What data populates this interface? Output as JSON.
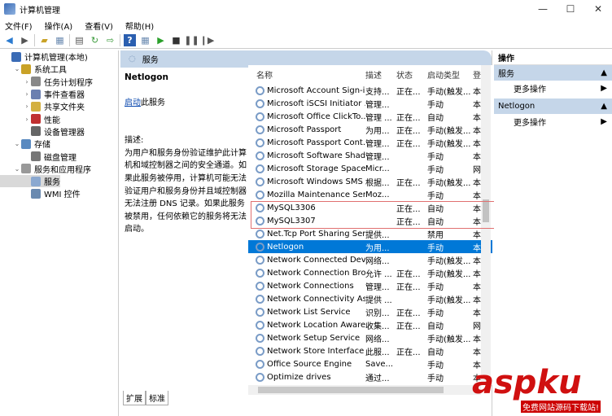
{
  "window": {
    "title": "计算机管理",
    "controls": [
      "—",
      "☐",
      "✕"
    ]
  },
  "menu": [
    "文件(F)",
    "操作(A)",
    "查看(V)",
    "帮助(H)"
  ],
  "toolbar": {
    "icons": [
      "back-icon",
      "forward-icon",
      "up-folder-icon",
      "show-hide-tree-icon",
      "properties-icon",
      "refresh-icon",
      "export-icon",
      "help-icon",
      "console-icon",
      "play-icon",
      "stop-icon",
      "pause-icon",
      "resume-icon"
    ]
  },
  "tree": [
    {
      "label": "计算机管理(本地)",
      "level": 0,
      "arrow": "",
      "color": "#3a6bb5"
    },
    {
      "label": "系统工具",
      "level": 1,
      "arrow": "⌄",
      "color": "#c9a227"
    },
    {
      "label": "任务计划程序",
      "level": 2,
      "arrow": "›",
      "color": "#888"
    },
    {
      "label": "事件查看器",
      "level": 2,
      "arrow": "›",
      "color": "#6b7fb0"
    },
    {
      "label": "共享文件夹",
      "level": 2,
      "arrow": "›",
      "color": "#d4b040"
    },
    {
      "label": "性能",
      "level": 2,
      "arrow": "›",
      "color": "#c03030"
    },
    {
      "label": "设备管理器",
      "level": 2,
      "arrow": "",
      "color": "#666"
    },
    {
      "label": "存储",
      "level": 1,
      "arrow": "⌄",
      "color": "#5a8ac0"
    },
    {
      "label": "磁盘管理",
      "level": 2,
      "arrow": "",
      "color": "#777"
    },
    {
      "label": "服务和应用程序",
      "level": 1,
      "arrow": "⌄",
      "color": "#999"
    },
    {
      "label": "服务",
      "level": 2,
      "arrow": "",
      "color": "#8aa8d0",
      "selected": true
    },
    {
      "label": "WMI 控件",
      "level": 2,
      "arrow": "",
      "color": "#6a8ab0"
    }
  ],
  "middle": {
    "header": "服务",
    "service_name": "Netlogon",
    "start_link": "启动",
    "start_suffix": "此服务",
    "desc_label": "描述:",
    "description": "为用户和服务身份验证维护此计算机和域控制器之间的安全通道。如果此服务被停用，计算机可能无法验证用户和服务身份并且域控制器无法注册 DNS 记录。如果此服务被禁用，任何依赖它的服务将无法启动。",
    "columns": [
      "名称",
      "描述",
      "状态",
      "启动类型",
      "登"
    ],
    "rows": [
      [
        "Microsoft Account Sign-i...",
        "支持...",
        "正在...",
        "手动(触发...",
        "本"
      ],
      [
        "Microsoft iSCSI Initiator ...",
        "管理...",
        "",
        "手动",
        "本"
      ],
      [
        "Microsoft Office ClickTo...",
        "管理 ...",
        "正在...",
        "自动",
        "本"
      ],
      [
        "Microsoft Passport",
        "为用...",
        "正在...",
        "手动(触发...",
        "本"
      ],
      [
        "Microsoft Passport Cont...",
        "管理...",
        "正在...",
        "手动(触发...",
        "本"
      ],
      [
        "Microsoft Software Shad...",
        "管理...",
        "",
        "手动",
        "本"
      ],
      [
        "Microsoft Storage Space...",
        "Micr...",
        "",
        "手动",
        "网"
      ],
      [
        "Microsoft Windows SMS ...",
        "根据...",
        "正在...",
        "手动(触发...",
        "本"
      ],
      [
        "Mozilla Maintenance Ser...",
        "Moz...",
        "",
        "手动",
        "本"
      ],
      [
        "MySQL3306",
        "",
        "正在...",
        "自动",
        "本"
      ],
      [
        "MySQL3307",
        "",
        "正在...",
        "自动",
        "本"
      ],
      [
        "Net.Tcp Port Sharing Ser...",
        "提供...",
        "",
        "禁用",
        "本"
      ],
      [
        "Netlogon",
        "为用...",
        "",
        "手动",
        "本"
      ],
      [
        "Network Connected Devi...",
        "网络...",
        "",
        "手动(触发...",
        "本"
      ],
      [
        "Network Connection Bro...",
        "允许 ...",
        "正在...",
        "手动(触发...",
        "本"
      ],
      [
        "Network Connections",
        "管理...",
        "正在...",
        "手动",
        "本"
      ],
      [
        "Network Connectivity Ass...",
        "提供 ...",
        "",
        "手动(触发...",
        "本"
      ],
      [
        "Network List Service",
        "识别...",
        "正在...",
        "手动",
        "本"
      ],
      [
        "Network Location Aware...",
        "收集...",
        "正在...",
        "自动",
        "网"
      ],
      [
        "Network Setup Service",
        "网络...",
        "",
        "手动(触发...",
        "本"
      ],
      [
        "Network Store Interface ...",
        "此服...",
        "正在...",
        "自动",
        "本"
      ],
      [
        "Office  Source Engine",
        "Save...",
        "",
        "手动",
        "本"
      ],
      [
        "Optimize drives",
        "通过...",
        "",
        "手动",
        "本"
      ]
    ],
    "selected_row": "Netlogon",
    "tabs": [
      "扩展",
      "标准"
    ]
  },
  "actions": {
    "title": "操作",
    "sections": [
      {
        "label": "服务",
        "item": "更多操作"
      },
      {
        "label": "Netlogon",
        "item": "更多操作"
      }
    ]
  },
  "watermark": {
    "logo": "aspku.com",
    "tagline": "免费网站源码下载站!"
  },
  "colors": {
    "selection": "#0078d7",
    "header": "#c5d6e9",
    "highlight_box": "#e07070"
  }
}
